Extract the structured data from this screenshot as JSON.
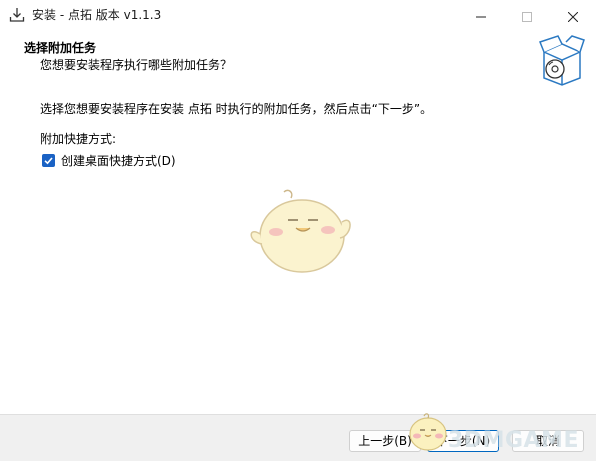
{
  "window": {
    "title": "安装 - 点拓 版本 v1.1.3",
    "icons": {
      "app": "install-download-icon",
      "minimize": "minimize-icon",
      "maximize": "maximize-icon",
      "close": "close-icon"
    }
  },
  "header": {
    "title": "选择附加任务",
    "subtitle": "您想要安装程序执行哪些附加任务？",
    "graphic": "setup-box-disc-icon"
  },
  "body": {
    "instruction": "选择您想要安装程序在安装 点拓 时执行的附加任务，然后点击“下一步”。",
    "group_label": "附加快捷方式:",
    "tasks": [
      {
        "label": "创建桌面快捷方式(D)",
        "checked": true
      }
    ]
  },
  "footer": {
    "back_label": "上一步(B)",
    "next_label": "下一步(N)",
    "cancel_label": "取消"
  },
  "watermark": {
    "text": "3DMGAME"
  },
  "colors": {
    "accent": "#1a62c4",
    "footer_bg": "#f0f0f0",
    "button_focus_border": "#0067c0"
  }
}
